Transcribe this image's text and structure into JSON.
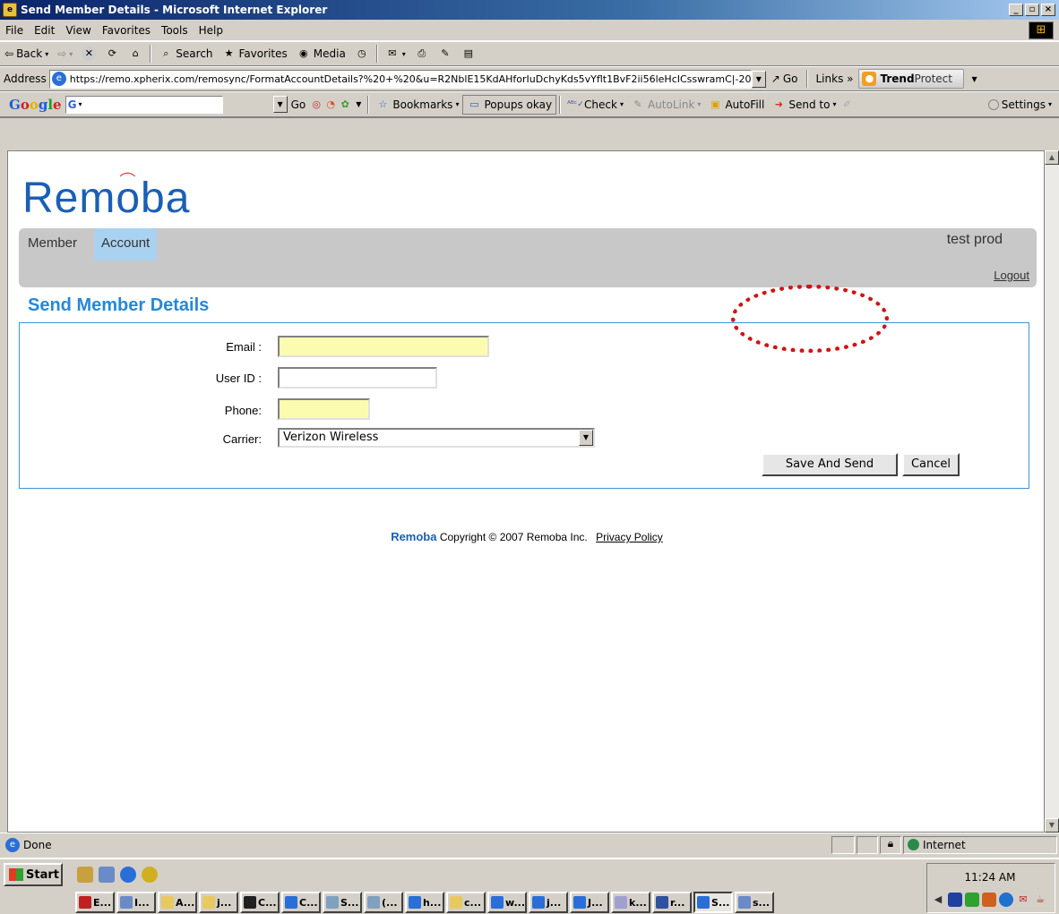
{
  "window": {
    "title": "Send Member Details - Microsoft Internet Explorer"
  },
  "menu": [
    "File",
    "Edit",
    "View",
    "Favorites",
    "Tools",
    "Help"
  ],
  "toolbar": {
    "back": "Back",
    "search": "Search",
    "favorites": "Favorites",
    "media": "Media"
  },
  "address": {
    "label": "Address",
    "url": "https://remo.xpherix.com/remosync/FormatAccountDetails?%20+%20&u=R2NblE15KdAHforIuDchyKds5vYflt1BvF2ii56leHcICsswramC|-206457",
    "go": "Go",
    "links": "Links",
    "trend_1": "Trend",
    "trend_2": "Protect"
  },
  "googlebar": {
    "logo": "Google",
    "g": "G",
    "go": "Go",
    "bookmarks": "Bookmarks",
    "popups": "Popups okay",
    "check": "Check",
    "autolink": "AutoLink",
    "autofill": "AutoFill",
    "sendto": "Send to",
    "settings": "Settings"
  },
  "page": {
    "logo": {
      "pre": "Rem",
      "mid": "o",
      "post": "ba"
    },
    "tabs": {
      "member": "Member",
      "account": "Account"
    },
    "username": "test prod",
    "logout": "Logout",
    "title": "Send Member Details",
    "form": {
      "email_label": "Email :",
      "email_value": "",
      "userid_label": "User ID :",
      "userid_value": "",
      "phone_label": "Phone:",
      "phone_value": "",
      "carrier_label": "Carrier:",
      "carrier_value": "Verizon Wireless",
      "save_label": "Save And Send",
      "cancel_label": "Cancel"
    },
    "footer": {
      "brand": "Remoba",
      "copyright": "Copyright © 2007 Remoba Inc.",
      "privacy": "Privacy Policy"
    }
  },
  "status": {
    "text": "Done",
    "zone": "Internet"
  },
  "taskbar": {
    "start": "Start",
    "time": "11:24 AM",
    "tasks": [
      "E...",
      "I...",
      "A...",
      "j...",
      "C...",
      "C...",
      "S...",
      "(...",
      "h...",
      "c...",
      "w...",
      "j...",
      "J...",
      "k...",
      "r...",
      "S...",
      "s..."
    ]
  },
  "colors": {
    "accent": "#2688d6",
    "field_highlight": "#fcfcb0",
    "annotation": "#d01414",
    "active_tab": "#a9d2f0"
  }
}
